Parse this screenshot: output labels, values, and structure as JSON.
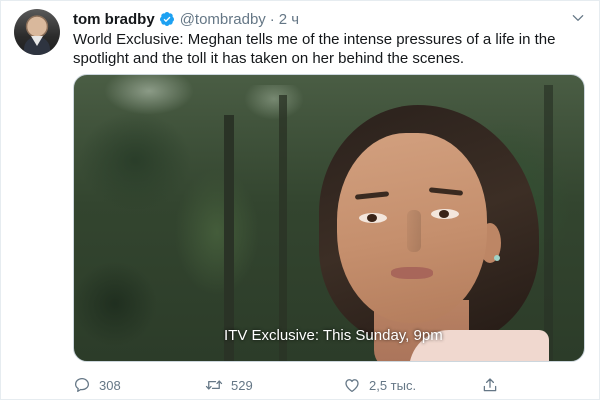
{
  "tweet": {
    "author_name": "tom bradby",
    "handle": "@tombradby",
    "separator": "·",
    "time": "2 ч",
    "text": "World Exclusive: Meghan tells me of the intense pressures of a life in the spotlight and the toll it has taken on her behind the scenes.",
    "media_caption": "ITV Exclusive: This Sunday, 9pm"
  },
  "actions": {
    "reply_count": "308",
    "retweet_count": "529",
    "like_count": "2,5 тыс."
  },
  "colors": {
    "verified": "#1da1f2",
    "secondary_text": "#657786",
    "primary_text": "#14171a"
  },
  "icons": {
    "verified": "verified-badge-icon",
    "menu": "chevron-down-icon",
    "reply": "reply-icon",
    "retweet": "retweet-icon",
    "like": "heart-icon",
    "share": "share-icon"
  }
}
